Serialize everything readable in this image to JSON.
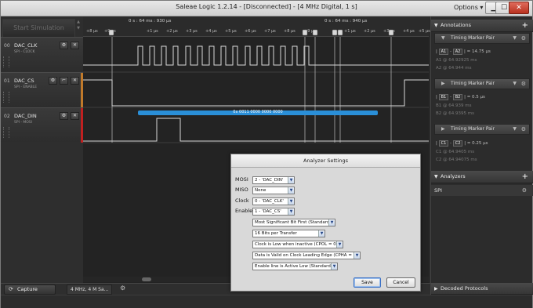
{
  "window": {
    "title": "Saleae Logic 1.2.14 - [Disconnected] - [4 MHz Digital, 1 s]",
    "options_label": "Options ▾",
    "minimize": "▁",
    "maximize": "☐",
    "close": "✕"
  },
  "toolbar": {
    "start_simulation": "Start Simulation"
  },
  "ruler": {
    "marker_left": "0 s : 64 ms : 930 μs",
    "marker_right": "0 s : 64 ms : 940 μs",
    "ticks_left": [
      "+8 μs",
      "+9 μs"
    ],
    "ticks_middle": [
      "+1 μs",
      "+2 μs",
      "+3 μs",
      "+4 μs",
      "+5 μs",
      "+6 μs",
      "+7 μs",
      "+8 μs",
      "+9 μs"
    ],
    "ticks_right": [
      "+1 μs",
      "+2 μs",
      "+3 μs",
      "+4 μs",
      "+5 μs"
    ]
  },
  "channels": [
    {
      "num": "00",
      "name": "DAC_CLK",
      "sub": "SPI - CLOCK",
      "color": "#2a2a2a"
    },
    {
      "num": "01",
      "name": "DAC_CS",
      "sub": "SPI - ENABLE",
      "color": "#c0792a"
    },
    {
      "num": "02",
      "name": "DAC_DIN",
      "sub": "SPI - MOSI",
      "color": "#c02020"
    }
  ],
  "decode": {
    "text": "0x 0011 0000 0000 0000",
    "color": "#2a8fd8"
  },
  "annotations": {
    "header": "Annotations",
    "pairs": [
      {
        "title": "Timing Marker Pair",
        "a": "A1",
        "b": "A2",
        "delta": "= 14.75 μs",
        "first_label": "A1",
        "first_value": "@ 64.92925 ms",
        "second_label": "A2",
        "second_value": "@ 64.944 ms"
      },
      {
        "title": "Timing Marker Pair",
        "a": "B1",
        "b": "B2",
        "delta": "= 0.5 μs",
        "first_label": "B1",
        "first_value": "@ 64.939 ms",
        "second_label": "B2",
        "second_value": "@ 64.9395 ms"
      },
      {
        "title": "Timing Marker Pair",
        "a": "C1",
        "b": "C2",
        "delta": "= 0.25 μs",
        "first_label": "C1",
        "first_value": "@ 64.9405 ms",
        "second_label": "C2",
        "second_value": "@ 64.94075 ms"
      }
    ]
  },
  "analyzers": {
    "header": "Analyzers",
    "items": [
      "SPI"
    ]
  },
  "decoded_protocols": {
    "header": "Decoded Protocols"
  },
  "bottom": {
    "capture_label": "Capture",
    "session_tab": "4 MHz, 4 M Sa..."
  },
  "dialog": {
    "title": "Analyzer Settings",
    "mosi_label": "MOSI",
    "mosi_value": "2 - 'DAC_DIN'",
    "miso_label": "MISO",
    "miso_value": "None",
    "clock_label": "Clock",
    "clock_value": "0 - 'DAC_CLK'",
    "enable_label": "Enable",
    "enable_value": "1 - 'DAC_CS'",
    "bit_order": "Most Significant Bit First (Standard)",
    "bits_per_transfer": "16 Bits per Transfer",
    "cpol": "Clock is Low when inactive (CPOL = 0)",
    "cpha": "Data is Valid on Clock Leading Edge (CPHA = 0)",
    "enable_polarity": "Enable line is Active Low (Standard)",
    "save_label": "Save",
    "cancel_label": "Cancel"
  }
}
